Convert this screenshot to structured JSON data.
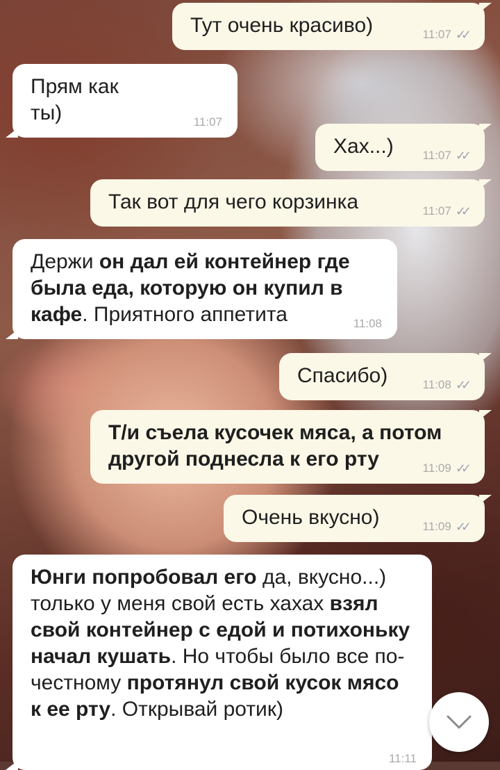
{
  "messages": [
    {
      "dir": "out",
      "time": "11:07",
      "parts": [
        {
          "t": "Тут очень красиво)",
          "b": false
        }
      ]
    },
    {
      "dir": "in",
      "time": "11:07",
      "parts": [
        {
          "t": "Прям как ты)",
          "b": false
        }
      ]
    },
    {
      "dir": "out",
      "time": "11:07",
      "parts": [
        {
          "t": "Хах...)",
          "b": false
        }
      ]
    },
    {
      "dir": "out",
      "time": "11:07",
      "parts": [
        {
          "t": "Так вот для чего корзинка",
          "b": false
        }
      ]
    },
    {
      "dir": "in",
      "time": "11:08",
      "parts": [
        {
          "t": "Держи ",
          "b": false
        },
        {
          "t": "он дал ей контейнер где была еда, которую он купил в кафе",
          "b": true
        },
        {
          "t": ". Приятного аппетита",
          "b": false
        }
      ]
    },
    {
      "dir": "out",
      "time": "11:08",
      "parts": [
        {
          "t": "Спасибо)",
          "b": false
        }
      ]
    },
    {
      "dir": "out",
      "time": "11:09",
      "parts": [
        {
          "t": "Т/и съела кусочек мяса, а потом другой поднесла к его рту",
          "b": true
        }
      ]
    },
    {
      "dir": "out",
      "time": "11:09",
      "parts": [
        {
          "t": "Очень вкусно)",
          "b": false
        }
      ]
    },
    {
      "dir": "in",
      "time": "11:11",
      "parts": [
        {
          "t": "Юнги попробовал его ",
          "b": true
        },
        {
          "t": "да, вкусно...) только у меня свой есть хахах ",
          "b": false
        },
        {
          "t": "взял свой контейнер с едой и потихоньку начал кушать",
          "b": true
        },
        {
          "t": ". Но чтобы было все по-честному ",
          "b": false
        },
        {
          "t": "протянул свой кусок мясо к ее рту",
          "b": true
        },
        {
          "t": ". Открывай ротик)",
          "b": false
        }
      ]
    }
  ],
  "scroll_button": {
    "icon": "chevron-down-icon"
  },
  "colors": {
    "incoming": "#ffffff",
    "outgoing": "#fcf8e8",
    "ticks": "#9aa7b4",
    "time": "#a9a9a9"
  }
}
